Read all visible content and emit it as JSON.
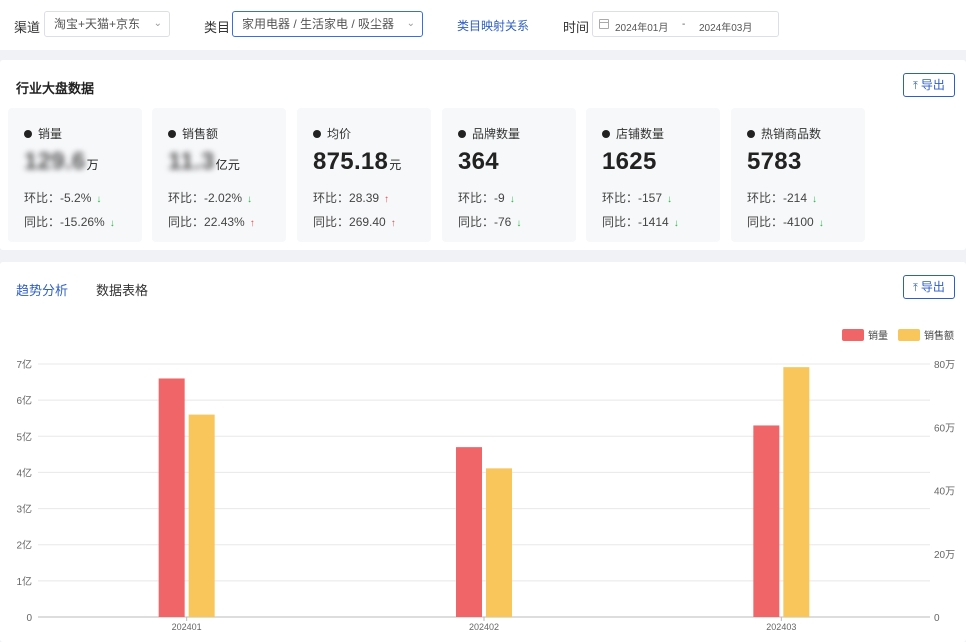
{
  "filters": {
    "channel_label": "渠道",
    "channel_value": "淘宝+天猫+京东",
    "category_label": "类目",
    "category_value": "家用电器 / 生活家电 / 吸尘器",
    "mapping_link": "类目映射关系",
    "time_label": "时间",
    "date_start": "2024年01月",
    "date_sep": "-",
    "date_end": "2024年03月"
  },
  "industry": {
    "title": "行业大盘数据",
    "export_label": "导出",
    "cards": [
      {
        "name": "销量",
        "value": "129.6",
        "unit": "万",
        "blur": true,
        "mom_label": "环比：",
        "mom": "-5.2%",
        "mom_dir": "down",
        "yoy_label": "同比：",
        "yoy": "-15.26%",
        "yoy_dir": "down"
      },
      {
        "name": "销售额",
        "value": "11.3",
        "unit": "亿元",
        "blur": true,
        "mom_label": "环比：",
        "mom": "-2.02%",
        "mom_dir": "down",
        "yoy_label": "同比：",
        "yoy": "22.43%",
        "yoy_dir": "up"
      },
      {
        "name": "均价",
        "value": "875.18",
        "unit": "元",
        "blur": false,
        "mom_label": "环比：",
        "mom": "28.39",
        "mom_dir": "up",
        "yoy_label": "同比：",
        "yoy": "269.40",
        "yoy_dir": "up"
      },
      {
        "name": "品牌数量",
        "value": "364",
        "unit": "",
        "blur": false,
        "mom_label": "环比：",
        "mom": "-9",
        "mom_dir": "down",
        "yoy_label": "同比：",
        "yoy": "-76",
        "yoy_dir": "down"
      },
      {
        "name": "店铺数量",
        "value": "1625",
        "unit": "",
        "blur": false,
        "mom_label": "环比：",
        "mom": "-157",
        "mom_dir": "down",
        "yoy_label": "同比：",
        "yoy": "-1414",
        "yoy_dir": "down"
      },
      {
        "name": "热销商品数",
        "value": "5783",
        "unit": "",
        "blur": false,
        "mom_label": "环比：",
        "mom": "-214",
        "mom_dir": "down",
        "yoy_label": "同比：",
        "yoy": "-4100",
        "yoy_dir": "down"
      }
    ]
  },
  "trend": {
    "tabs": [
      {
        "label": "趋势分析",
        "active": true
      },
      {
        "label": "数据表格",
        "active": false
      }
    ],
    "export_label": "导出"
  },
  "colors": {
    "sales_volume": "#f06668",
    "sales_amount": "#f8c65a",
    "accent": "#2f5fc4"
  },
  "chart_data": {
    "type": "bar",
    "categories": [
      "202401",
      "202402",
      "202403"
    ],
    "series": [
      {
        "name": "销量",
        "axis": "left",
        "values": [
          660000000,
          470000000,
          530000000
        ]
      },
      {
        "name": "销售额",
        "axis": "right",
        "values": [
          640000,
          470000,
          790000
        ]
      }
    ],
    "y_left": {
      "ticks": [
        "0",
        "1亿",
        "2亿",
        "3亿",
        "4亿",
        "5亿",
        "6亿",
        "7亿"
      ],
      "ylim": [
        0,
        700000000
      ]
    },
    "y_right": {
      "ticks": [
        "0",
        "20万",
        "40万",
        "60万",
        "80万"
      ],
      "ylim": [
        0,
        800000
      ]
    },
    "legend": "top-right",
    "grid": true
  }
}
